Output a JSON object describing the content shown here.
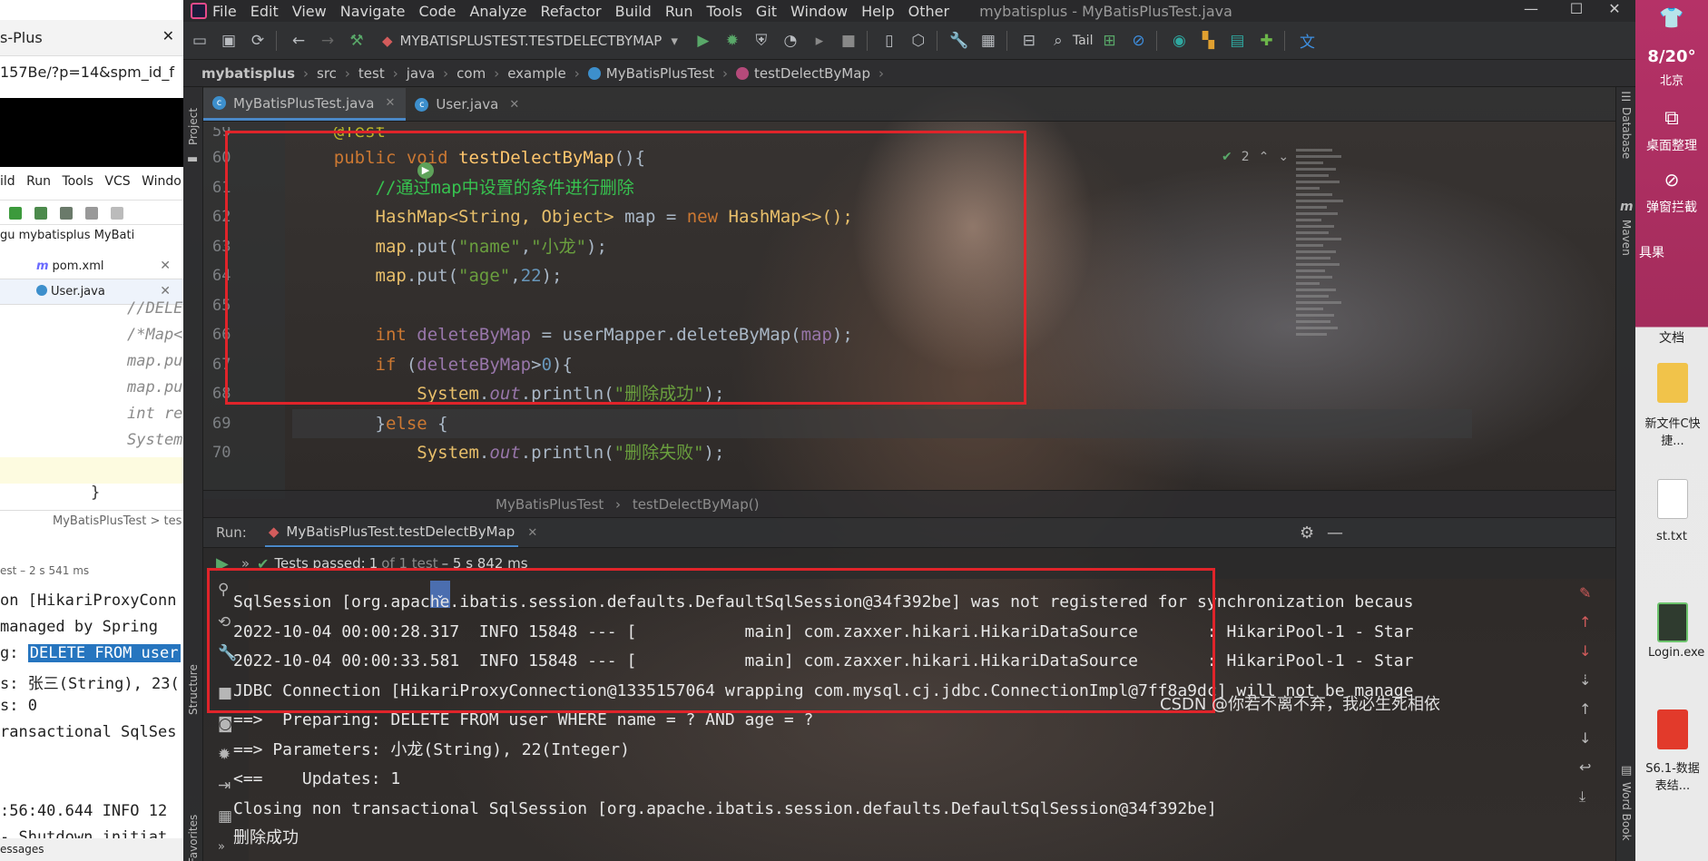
{
  "left_window": {
    "browser_tab": "s-Plus",
    "url_fragment": "157Be/?p=14&spm_id_f",
    "menu": [
      "ild",
      "Run",
      "Tools",
      "VCS",
      "Windo"
    ],
    "crumbs": "gu  mybatisplus  MyBati",
    "file_tabs": [
      "pom.xml",
      "User.java"
    ],
    "code_lines": [
      "//DELE",
      "/*Map<",
      "map.pu",
      "map.pu",
      "int re",
      "System",
      "",
      "}"
    ],
    "crumb_bottom": "MyBatisPlusTest  >  tes",
    "run_status": "est – 2 s 541 ms",
    "console": [
      "on [HikariProxyConn",
      "managed by Spring",
      "g:",
      "DELETE FROM user",
      "s: 张三(String), 23(",
      "s: 0",
      "ransactional SqlSes",
      "",
      "",
      ":56:40.644  INFO 12",
      " - Shutdown initiat"
    ],
    "bottom_label": "essages"
  },
  "desktop": {
    "date": "8/20°",
    "city": "北京",
    "items": [
      "桌面整理",
      "弹窗拦截",
      "具果",
      "文档",
      "新文件C快捷...",
      "st.txt",
      "Login.exe",
      "S6.1-数据表结..."
    ]
  },
  "ide": {
    "menu": [
      "File",
      "Edit",
      "View",
      "Navigate",
      "Code",
      "Analyze",
      "Refactor",
      "Build",
      "Run",
      "Tools",
      "Git",
      "Window",
      "Help",
      "Other"
    ],
    "window_title": "mybatisplus - MyBatisPlusTest.java",
    "run_config": "MYBATISPLUSTEST.TESTDELECTBYMAP",
    "tail_label": "Tail",
    "breadcrumb": [
      "mybatisplus",
      "src",
      "test",
      "java",
      "com",
      "example",
      "MyBatisPlusTest",
      "testDelectByMap"
    ],
    "tabs": [
      "MyBatisPlusTest.java",
      "User.java"
    ],
    "side_labels": {
      "left": [
        "Project",
        "Structure",
        "Favorites"
      ],
      "right": [
        "Database",
        "Maven",
        "Word Book"
      ]
    },
    "inspection_count": "2",
    "line_numbers": [
      "59",
      "60",
      "61",
      "62",
      "63",
      "64",
      "65",
      "66",
      "67",
      "68",
      "69",
      "70"
    ],
    "editor_crumb": [
      "MyBatisPlusTest",
      "testDelectByMap()"
    ],
    "run_label": "Run:",
    "run_tab": "MyBatisPlusTest.testDelectByMap",
    "test_status": {
      "passed": "Tests passed:",
      "count": "1",
      "of": "of 1 test",
      "time": "– 5 s 842 ms"
    },
    "console_lines": [
      "SqlSession [org.apache.ibatis.session.defaults.DefaultSqlSession@34f392be] was not registered for synchronization becaus",
      "2022-10-04 00:00:28.317  INFO 15848 --- [           main] com.zaxxer.hikari.HikariDataSource       : HikariPool-1 - Star",
      "2022-10-04 00:00:33.581  INFO 15848 --- [           main] com.zaxxer.hikari.HikariDataSource       : HikariPool-1 - Star",
      "JDBC Connection [HikariProxyConnection@1335157064 wrapping com.mysql.cj.jdbc.ConnectionImpl@7ff8a9dc] will not be manage",
      "==>  Preparing: DELETE FROM user WHERE name = ? AND age = ?",
      "==> Parameters: 小龙(String), 22(Integer)",
      "<==    Updates: 1",
      "Closing non transactional SqlSession [org.apache.ibatis.session.defaults.DefaultSqlSession@34f392be]",
      "删除成功"
    ]
  },
  "code": {
    "l59": "@Test",
    "l60": {
      "kw1": "public",
      "kw2": "void",
      "name": "testDelectByMap",
      "tail": "(){"
    },
    "l61": "//通过map中设置的条件进行删除",
    "l62": {
      "t1": "HashMap<String, Object>",
      "var": "map",
      "eq": " = ",
      "kw": "new",
      "t2": " HashMap<>();"
    },
    "l63": {
      "obj": "map",
      "call": ".put(",
      "s1": "\"name\"",
      "comma": ",",
      "s2": "\"小龙\"",
      "end": ");"
    },
    "l64": {
      "obj": "map",
      "call": ".put(",
      "s1": "\"age\"",
      "comma": ",",
      "n": "22",
      "end": ");"
    },
    "l66": {
      "kw": "int",
      "var": "deleteByMap",
      "eq": " = ",
      "obj": "userMapper",
      "call": ".deleteByMap(",
      "arg": "map",
      "end": ");"
    },
    "l67": {
      "kw": "if",
      "open": " (",
      "var": "deleteByMap",
      "op": ">",
      "n": "0",
      "end": "){"
    },
    "l68": {
      "cls": "System",
      "dot": ".",
      "fld": "out",
      "call": ".println(",
      "s": "\"删除成功\"",
      "end": ");"
    },
    "l69": {
      "brace": "}",
      "kw": "else",
      "end": " {"
    },
    "l70": {
      "cls": "System",
      "dot": ".",
      "fld": "out",
      "call": ".println(",
      "s": "\"删除失败\"",
      "end": ");"
    }
  },
  "watermark": "CSDN @你若不离不弃，我必生死相依",
  "colors": {
    "annotation_box": "#e0242a",
    "keyword": "#cc7832",
    "comment": "#37c24f",
    "string": "#6a9f3e",
    "number": "#6897bb",
    "field": "#9876aa",
    "accent": "#4a88c7"
  }
}
